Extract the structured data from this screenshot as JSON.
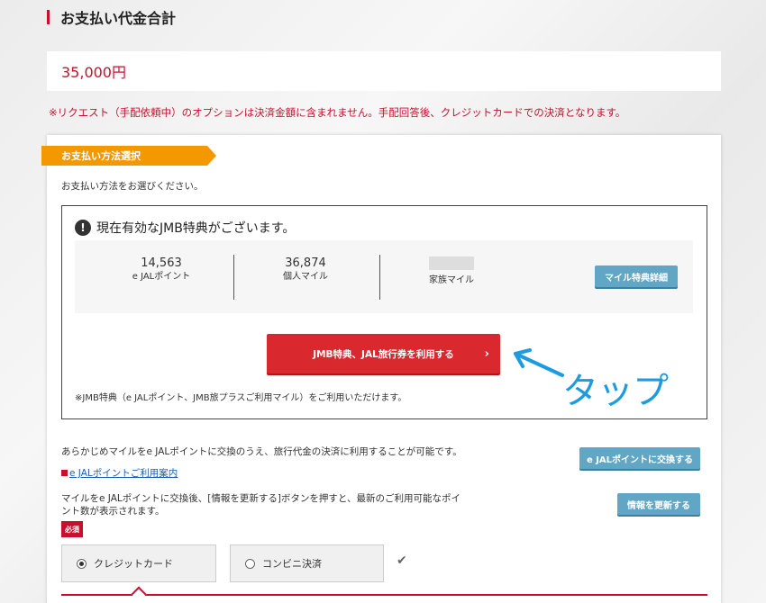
{
  "page": {
    "title": "お支払い代金合計",
    "total_amount": "35,000円",
    "notice": "※リクエスト（手配依頼中）のオプションは決済金額に含まれません。手配回答後、クレジットカードでの決済となります。"
  },
  "payment_section": {
    "ribbon_label": "お支払い方法選択",
    "instruction": "お支払い方法をお選びください。",
    "jmb": {
      "heading": "現在有効なJMB特典がございます。",
      "stats": [
        {
          "value": "14,563",
          "label": "e JALポイント"
        },
        {
          "value": "36,874",
          "label": "個人マイル"
        },
        {
          "value": "",
          "label": "家族マイル"
        }
      ],
      "detail_button": "マイル特典詳細",
      "use_button": "JMB特典、JAL旅行券を利用する",
      "note": "※JMB特典（e JALポイント、JMB旅プラスご利用マイル）をご利用いただけます。"
    },
    "exchange_text": "あらかじめマイルをe JALポイントに交換のうえ、旅行代金の決済に利用することが可能です。",
    "exchange_button": "e JALポイントに交換する",
    "guide_link": "e JALポイントご利用案内",
    "update_text_line1": "マイルをe JALポイントに交換後、[情報を更新する]ボタンを押すと、最新のご利用可能なポイ",
    "update_text_line2": "ント数が表示されます。",
    "update_button": "情報を更新する",
    "required_badge": "必須",
    "options": [
      {
        "label": "クレジットカード",
        "selected": true
      },
      {
        "label": "コンビニ決済",
        "selected": false
      }
    ]
  },
  "annotation": {
    "text": "タップ",
    "color": "#1d9be0"
  },
  "colors": {
    "accent_red": "#c8102e",
    "ribbon_orange": "#f39800",
    "button_blue": "#62a6c6",
    "button_red": "#d9292f"
  }
}
